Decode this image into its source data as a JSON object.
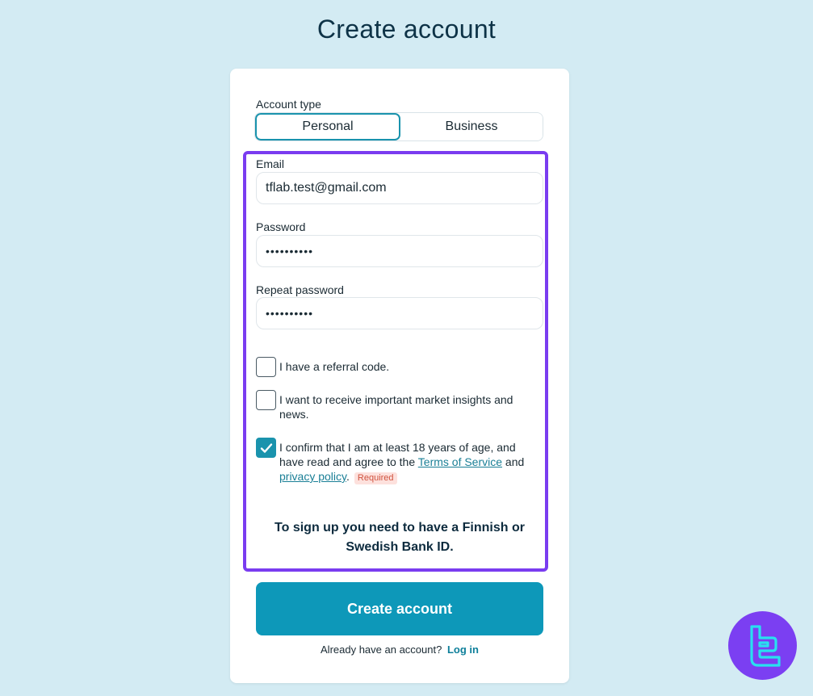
{
  "page": {
    "title": "Create account"
  },
  "account_type": {
    "label": "Account type",
    "options": [
      "Personal",
      "Business"
    ],
    "selected": "Personal"
  },
  "email": {
    "label": "Email",
    "value": "tflab.test@gmail.com"
  },
  "password": {
    "label": "Password",
    "value": "••••••••••"
  },
  "repeat_password": {
    "label": "Repeat password",
    "value": "••••••••••"
  },
  "checkboxes": {
    "referral": {
      "label": "I have a referral code.",
      "checked": false
    },
    "insights": {
      "label": "I want to receive important market insights and news.",
      "checked": false
    },
    "confirm": {
      "text_before": "I confirm that I am at least 18 years of age, and have read and agree to the ",
      "terms_link": "Terms of Service",
      "text_and": " and ",
      "privacy_link": "privacy policy",
      "text_end": ".",
      "required_badge": "Required",
      "checked": true
    }
  },
  "bankid_note": "To sign up you need to have a Finnish or Swedish Bank ID.",
  "create_button": "Create account",
  "login": {
    "prompt": "Already have an account?",
    "link": "Log in"
  },
  "colors": {
    "background": "#d3ebf3",
    "accent": "#0d98b9",
    "highlight": "#7a3cf0",
    "badge_bg": "#fde1dd",
    "badge_text": "#d0533f",
    "logo_bg": "#7b3ff2",
    "logo_fg": "#28e0f0"
  },
  "icons": {
    "checkmark": "check-icon",
    "logo": "brand-logo"
  }
}
